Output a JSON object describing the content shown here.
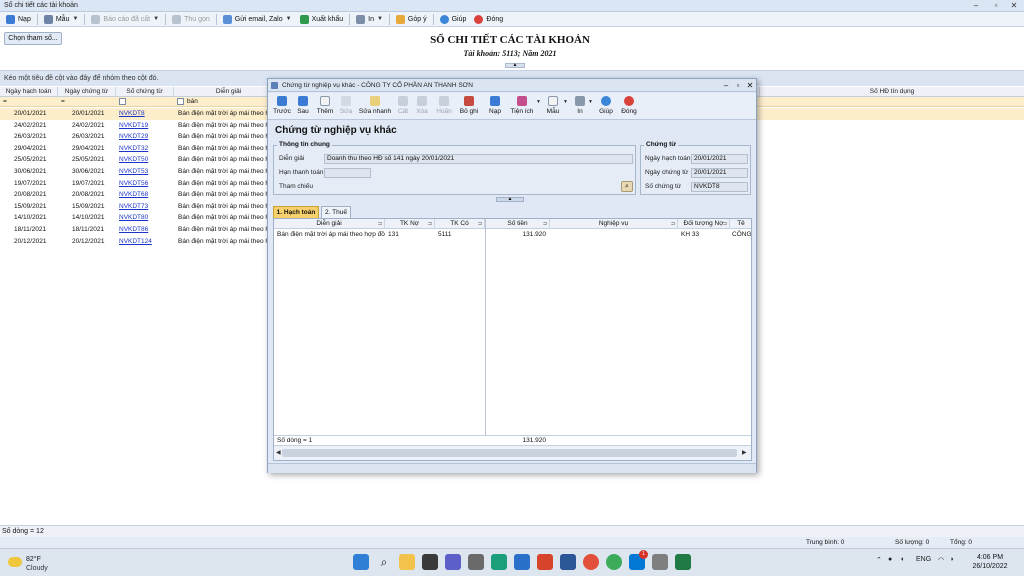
{
  "window": {
    "title": "Sổ chi tiết các tài khoản"
  },
  "toolbar": {
    "nap": "Nạp",
    "mau": "Mẫu",
    "bao_cao_da_cat": "Báo cáo đã cất",
    "thu_gon": "Thu gọn",
    "gui_email": "Gửi email, Zalo",
    "xuat_khau": "Xuất khẩu",
    "in": "In",
    "gop_y": "Góp ý",
    "giup": "Giúp",
    "dong": "Đóng"
  },
  "report": {
    "choose_button": "Chọn tham số...",
    "title": "SỔ CHI TIẾT CÁC TÀI KHOẢN",
    "subtitle": "Tài khoản: 5113; Năm 2021",
    "group_hint": "Kéo một tiêu đề cột vào đây để nhóm theo cột đó."
  },
  "grid": {
    "headers": {
      "ngay_hach_toan": "Ngày hạch toán",
      "ngay_chung_tu": "Ngày chứng từ",
      "so_chung_tu": "Số chứng từ",
      "dien_giai": "Diễn giải",
      "so_hd_tin_dung": "Số HĐ tín dụng"
    },
    "filter": {
      "c1": "=",
      "c2": "=",
      "dien_giai": "bán"
    },
    "rows": [
      {
        "ngay_ht": "20/01/2021",
        "ngay_ct": "20/01/2021",
        "so_ct": "NVKDT8",
        "dien_giai": "Bán điện mặt trời áp mái theo hợp"
      },
      {
        "ngay_ht": "24/02/2021",
        "ngay_ct": "24/02/2021",
        "so_ct": "NVKDT19",
        "dien_giai": "Bán điện mặt trời áp mái theo hợp"
      },
      {
        "ngay_ht": "26/03/2021",
        "ngay_ct": "26/03/2021",
        "so_ct": "NVKDT29",
        "dien_giai": "Bán điện mặt trời áp mái theo hợp"
      },
      {
        "ngay_ht": "29/04/2021",
        "ngay_ct": "29/04/2021",
        "so_ct": "NVKDT32",
        "dien_giai": "Bán điện mặt trời áp mái theo hợp"
      },
      {
        "ngay_ht": "25/05/2021",
        "ngay_ct": "25/05/2021",
        "so_ct": "NVKDT50",
        "dien_giai": "Bán điện mặt trời áp mái theo hợp"
      },
      {
        "ngay_ht": "30/06/2021",
        "ngay_ct": "30/06/2021",
        "so_ct": "NVKDT53",
        "dien_giai": "Bán điện mặt trời áp mái theo hợp"
      },
      {
        "ngay_ht": "19/07/2021",
        "ngay_ct": "19/07/2021",
        "so_ct": "NVKDT56",
        "dien_giai": "Bán điện mặt trời áp mái theo hợp"
      },
      {
        "ngay_ht": "20/08/2021",
        "ngay_ct": "20/08/2021",
        "so_ct": "NVKDT68",
        "dien_giai": "Bán điện mặt trời áp mái theo hợp"
      },
      {
        "ngay_ht": "15/09/2021",
        "ngay_ct": "15/09/2021",
        "so_ct": "NVKDT73",
        "dien_giai": "Bán điện mặt trời áp mái theo hợp"
      },
      {
        "ngay_ht": "14/10/2021",
        "ngay_ct": "14/10/2021",
        "so_ct": "NVKDT80",
        "dien_giai": "Bán điện mặt trời áp mái theo hợp"
      },
      {
        "ngay_ht": "18/11/2021",
        "ngay_ct": "18/11/2021",
        "so_ct": "NVKDT86",
        "dien_giai": "Bán điện mặt trời áp mái theo hợp"
      },
      {
        "ngay_ht": "20/12/2021",
        "ngay_ct": "20/12/2021",
        "so_ct": "NVKDT124",
        "dien_giai": "Bán điện mặt trời áp mái theo hợp"
      }
    ]
  },
  "status": {
    "so_dong": "Số dòng = 12",
    "trung_binh": "Trung bình: 0",
    "so_luong": "Số lượng: 0",
    "tong": "Tổng: 0"
  },
  "dialog": {
    "title": "Chứng từ nghiệp vụ khác - CÔNG TY CỔ PHẦN AN THANH SƠN",
    "heading": "Chứng từ nghiệp vụ khác",
    "toolbar": {
      "truoc": "Trước",
      "sau": "Sau",
      "them": "Thêm",
      "sua": "Sửa",
      "sua_nhanh": "Sửa nhanh",
      "cat": "Cất",
      "xoa": "Xóa",
      "hoan": "Hoãn",
      "bo_ghi": "Bỏ ghi",
      "nap": "Nạp",
      "tien_ich": "Tiện ích",
      "mau": "Mẫu",
      "in": "In",
      "giup": "Giúp",
      "dong": "Đóng"
    },
    "general": {
      "legend": "Thông tin chung",
      "dien_giai_label": "Diễn giải",
      "dien_giai_value": "Doanh thu theo  HĐ số 141 ngày 20/01/2021",
      "han_thanh_toan_label": "Hạn thanh toán",
      "han_thanh_toan_value": "",
      "tham_chieu_label": "Tham chiếu"
    },
    "voucher": {
      "legend": "Chứng từ",
      "ngay_hach_toan_label": "Ngày hạch toán",
      "ngay_hach_toan_value": "20/01/2021",
      "ngay_chung_tu_label": "Ngày chứng từ",
      "ngay_chung_tu_value": "20/01/2021",
      "so_chung_tu_label": "Số chứng từ",
      "so_chung_tu_value": "NVKDT8"
    },
    "tabs": [
      "1. Hạch toán",
      "2. Thuế"
    ],
    "grid": {
      "headers": {
        "dien_giai": "Diễn giải",
        "tk_no": "TK Nợ",
        "tk_co": "TK Có",
        "so_tien": "Số tiền",
        "nghiep_vu": "Nghiệp vụ",
        "doi_tuong_no": "Đối tượng Nợ",
        "ten": "Tê"
      },
      "row": {
        "dien_giai": "Bán điện mặt trời áp mái theo hợp đồng",
        "tk_no": "131",
        "tk_co": "5111",
        "so_tien": "131.920",
        "nghiep_vu": "",
        "doi_tuong_no": "KH 33",
        "ten": "CÔNG"
      },
      "footer_count": "Số dòng = 1",
      "footer_total": "131.920"
    }
  },
  "taskbar": {
    "weather_temp": "82°F",
    "weather_desc": "Cloudy",
    "lang": "ENG",
    "time": "4:06 PM",
    "date": "26/10/2022",
    "badge": "1"
  }
}
